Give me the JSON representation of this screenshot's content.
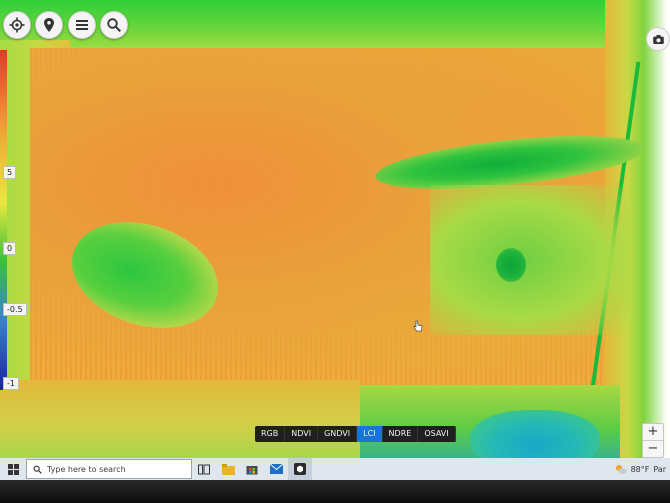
{
  "toolbar": {
    "buttons": [
      {
        "name": "locate-icon"
      },
      {
        "name": "pin-icon"
      },
      {
        "name": "list-icon"
      },
      {
        "name": "search-icon"
      }
    ]
  },
  "legend": {
    "labels": [
      "5",
      "0",
      "-0.5",
      "-1"
    ],
    "colors": [
      "#e23a2b",
      "#f1a938",
      "#e8e83c",
      "#39c23b",
      "#3a7fd0",
      "#1a1fa8"
    ]
  },
  "index_selector": {
    "options": [
      "RGB",
      "NDVI",
      "GNDVI",
      "LCI",
      "NDRE",
      "OSAVI"
    ],
    "selected": "LCI"
  },
  "zoom": {
    "in": "+",
    "out": "−"
  },
  "taskbar": {
    "search_placeholder": "Type here to search",
    "weather": "88°F",
    "weather_partial": "Par"
  },
  "colors": {
    "accent": "#1874d6"
  }
}
